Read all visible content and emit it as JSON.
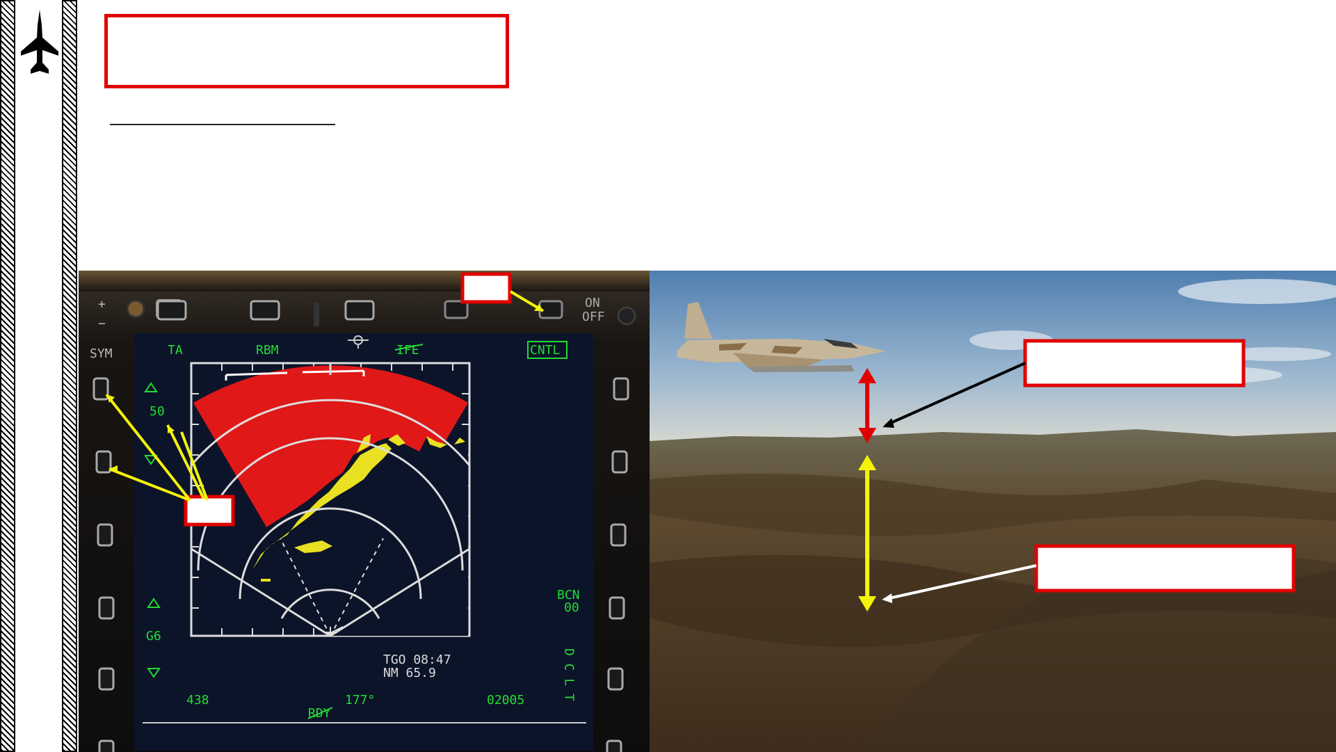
{
  "mfd": {
    "top_labels": {
      "ta": "TA",
      "rbm": "RBM",
      "ife": "IFE",
      "cntl": "CNTL"
    },
    "power_switch": {
      "on": "ON",
      "off": "OFF"
    },
    "left_labels": {
      "sym": "SYM",
      "gain": "50",
      "gain_alt": "G6"
    },
    "right_labels": {
      "bcn_line1": "BCN",
      "bcn_line2": "00",
      "dclt": "D C L T"
    },
    "readouts": {
      "tgo": "TGO 08:47",
      "nm": "NM  65.9",
      "bottom_left": "438",
      "heading": "177°",
      "bottom_right": "02005",
      "rdy": "RDY"
    },
    "colors": {
      "symbology": "#22dd33",
      "terrain_shadow": "#e01818",
      "terrain_return": "#e8e020",
      "callout_border": "#e00000",
      "arrow_red": "#e00000",
      "arrow_yellow": "#f4f40a"
    },
    "buttons": {
      "plus": "+",
      "minus": "−"
    }
  }
}
